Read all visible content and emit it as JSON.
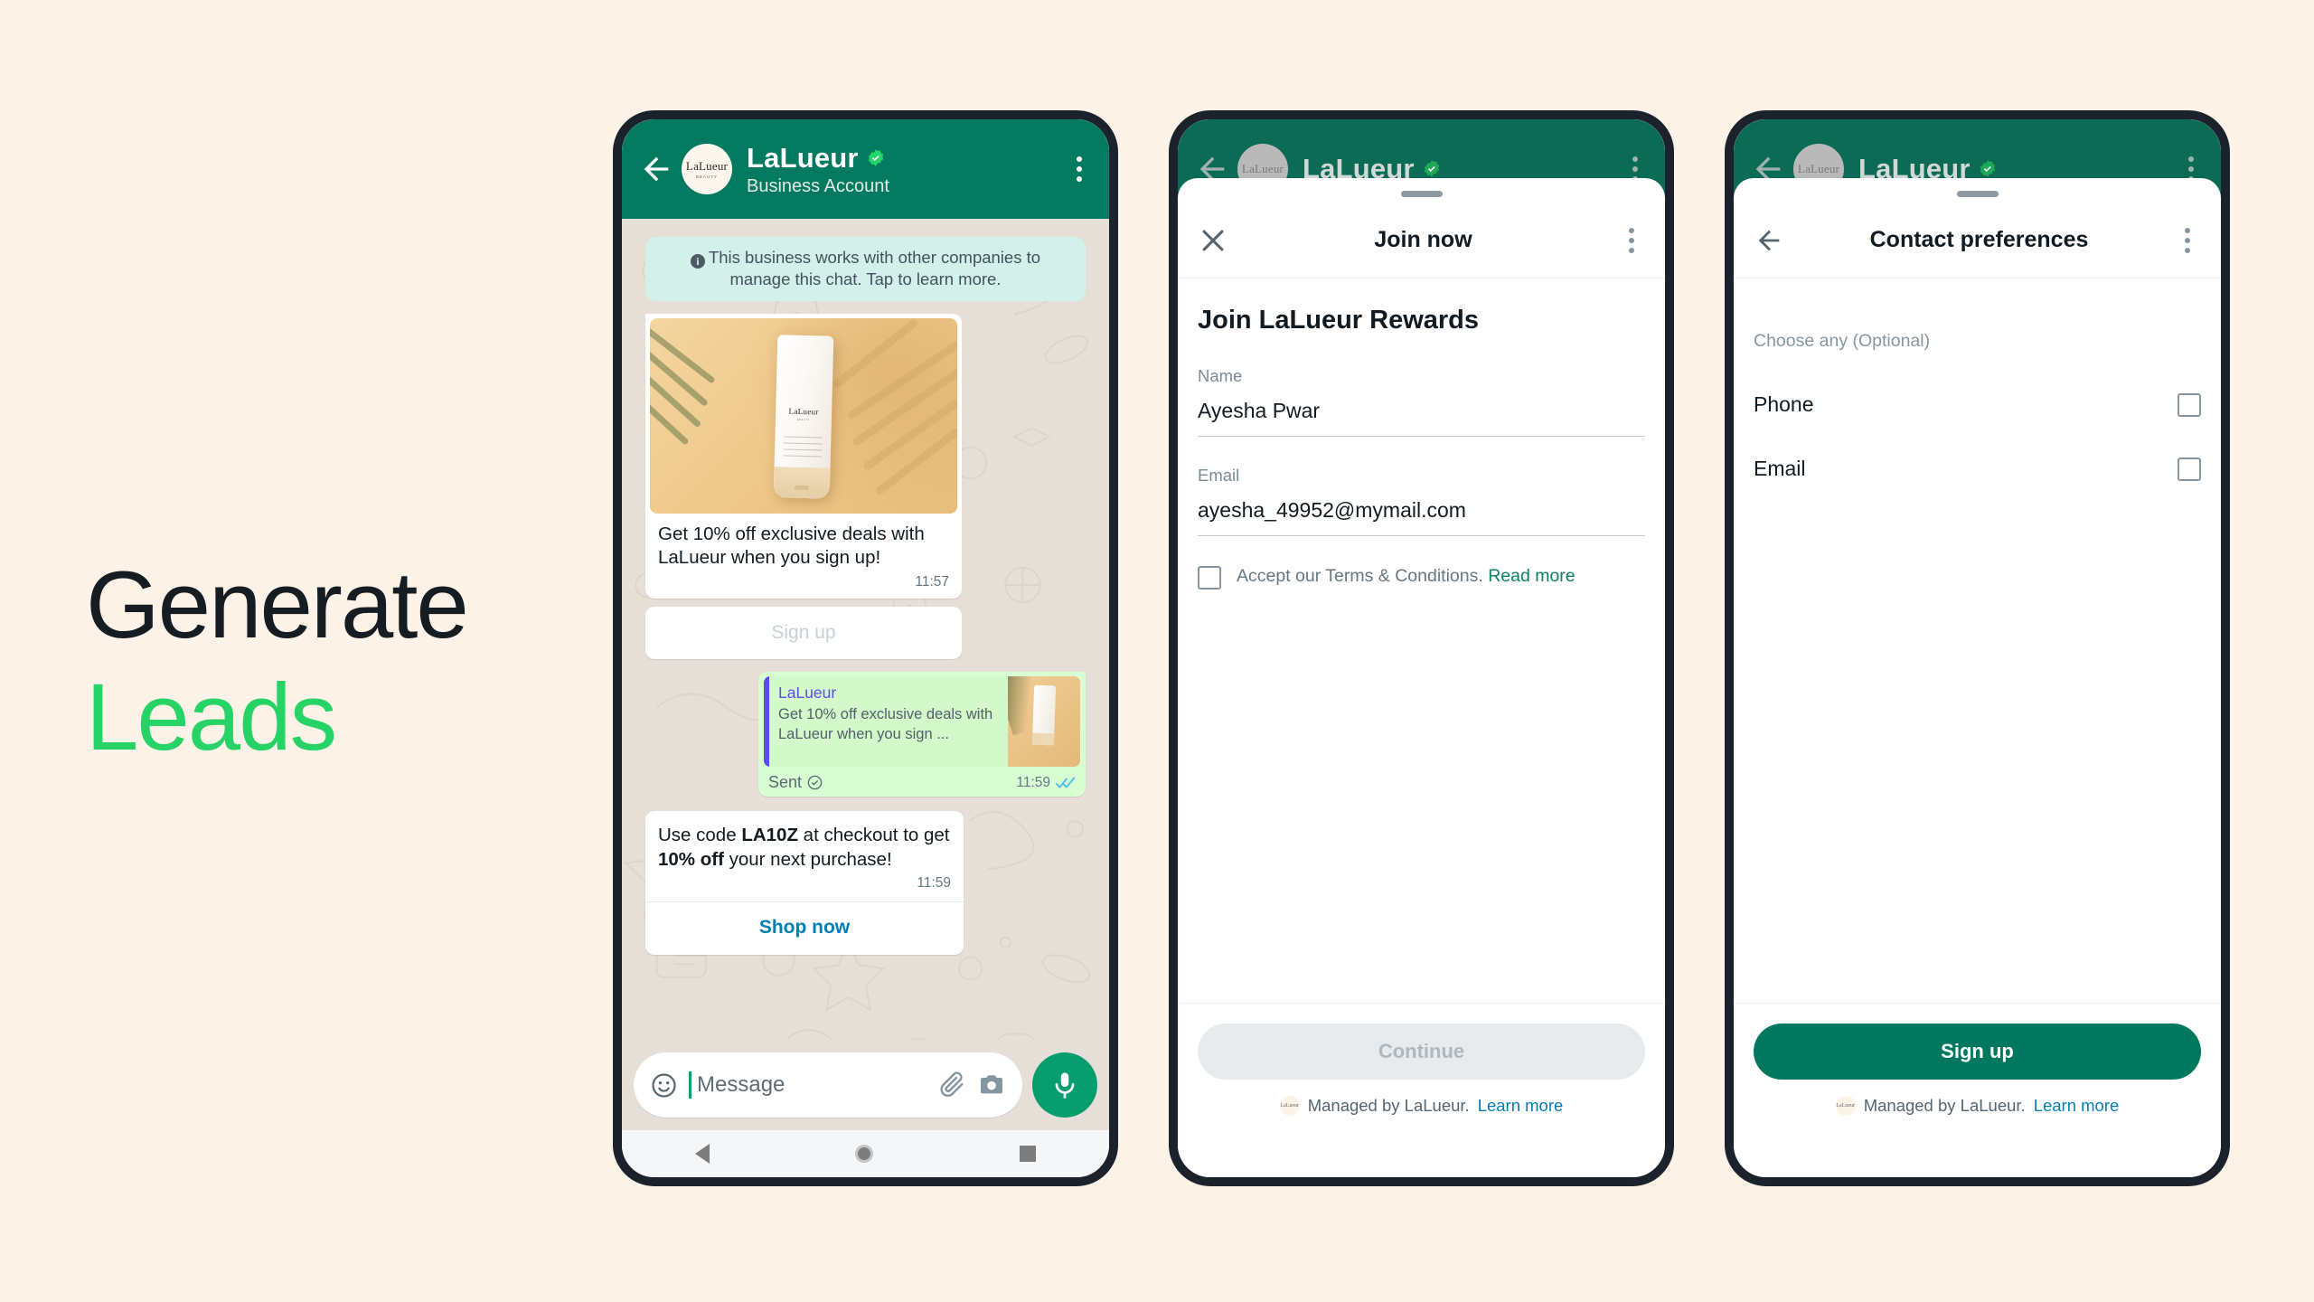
{
  "headline": {
    "line1": "Generate",
    "line2": "Leads"
  },
  "colors": {
    "page_background": "#FCF2E7",
    "accent_green": "#27D367",
    "header_green": "#047B60",
    "button_green": "#00785F",
    "link_blue": "#027EB5",
    "quote_purple": "#5D4DE8",
    "chat_background": "#E6DFD7",
    "outgoing_bubble": "#D9FDD3"
  },
  "phone1": {
    "header": {
      "back_icon": "back-arrow-icon",
      "avatar_name": "LaLueur",
      "avatar_sub": "BEAUTY",
      "name": "LaLueur",
      "verified_icon": "verified-badge-icon",
      "subtitle": "Business Account",
      "menu_icon": "kebab-menu-icon"
    },
    "info_banner": {
      "icon": "info-icon",
      "text": "This business works with other companies to manage this chat. Tap to learn more."
    },
    "message_1": {
      "media_alt": "LaLueur moisturizing face cream tube on yellow background",
      "product_brand": "LaLueur",
      "product_brand_sub": "BEAUTY",
      "product_label": "MOISTURIZING FACE CREAM",
      "text": "Get 10% off exclusive deals with LaLueur when you sign up!",
      "time": "11:57",
      "cta_label": "Sign up"
    },
    "message_2": {
      "quote_name": "LaLueur",
      "quote_text": "Get 10% off exclusive deals with LaLueur when you sign ...",
      "status_label": "Sent",
      "status_icon": "check-circle-icon",
      "time": "11:59",
      "ticks_icon": "double-check-icon"
    },
    "message_3": {
      "text_part1": "Use code ",
      "text_bold1": "LA10Z",
      "text_part2": " at checkout to get ",
      "text_bold2": "10% off",
      "text_part3": " your next purchase!",
      "time": "11:59",
      "cta_label": "Shop now"
    },
    "input_bar": {
      "emoji_icon": "emoji-icon",
      "placeholder": "Message",
      "attach_icon": "paperclip-icon",
      "camera_icon": "camera-icon",
      "mic_icon": "microphone-icon"
    }
  },
  "phone2": {
    "header": {
      "name": "LaLueur",
      "avatar_name": "LaLueur"
    },
    "sheet": {
      "close_icon": "close-icon",
      "title": "Join now",
      "menu_icon": "kebab-menu-icon",
      "heading": "Join LaLueur Rewards",
      "fields": [
        {
          "label": "Name",
          "value": "Ayesha Pwar"
        },
        {
          "label": "Email",
          "value": "ayesha_49952@mymail.com"
        }
      ],
      "terms_text": "Accept our Terms & Conditions. ",
      "terms_link": "Read more",
      "terms_checked": false,
      "primary_button": "Continue",
      "primary_button_state": "disabled",
      "footer_text": "Managed by LaLueur. ",
      "footer_link": "Learn more",
      "footer_logo": "lalueur-logo-icon"
    }
  },
  "phone3": {
    "header": {
      "name": "LaLueur",
      "avatar_name": "LaLueur"
    },
    "sheet": {
      "back_icon": "back-arrow-icon",
      "title": "Contact preferences",
      "menu_icon": "kebab-menu-icon",
      "subtitle": "Choose any (Optional)",
      "options": [
        {
          "label": "Phone",
          "checked": false
        },
        {
          "label": "Email",
          "checked": false
        }
      ],
      "primary_button": "Sign up",
      "primary_button_state": "active",
      "footer_text": "Managed by LaLueur. ",
      "footer_link": "Learn more",
      "footer_logo": "lalueur-logo-icon"
    }
  }
}
